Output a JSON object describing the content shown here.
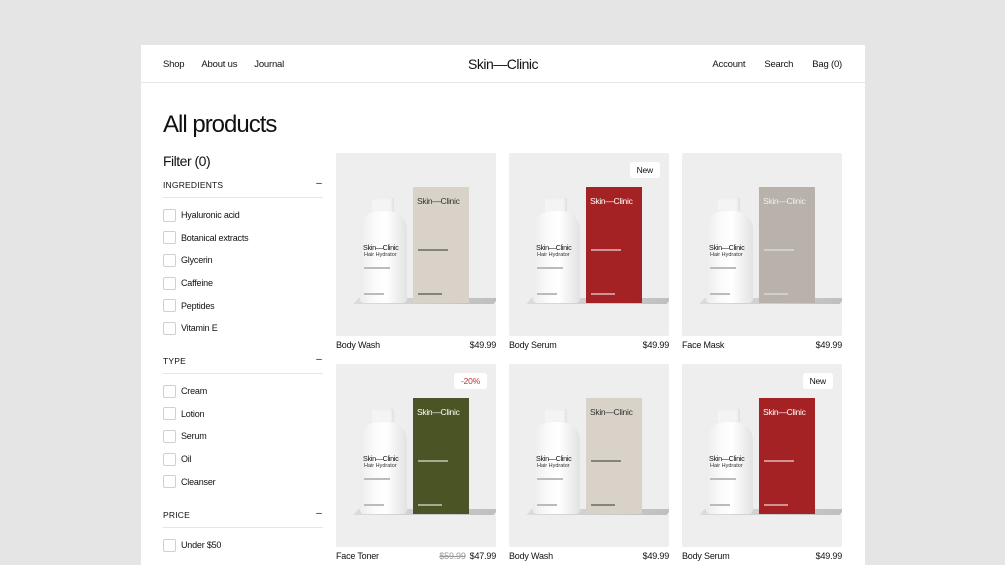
{
  "header": {
    "nav_left": [
      "Shop",
      "About us",
      "Journal"
    ],
    "logo": "Skin—Clinic",
    "nav_right": [
      "Account",
      "Search",
      "Bag (0)"
    ]
  },
  "page_title": "All products",
  "filter": {
    "title": "Filter (0)",
    "sections": [
      {
        "label": "INGREDIENTS",
        "toggle": "–",
        "options": [
          "Hyaluronic acid",
          "Botanical extracts",
          "Glycerin",
          "Caffeine",
          "Peptides",
          "Vitamin E"
        ]
      },
      {
        "label": "TYPE",
        "toggle": "–",
        "options": [
          "Cream",
          "Lotion",
          "Serum",
          "Oil",
          "Cleanser"
        ]
      },
      {
        "label": "PRICE",
        "toggle": "–",
        "options": [
          "Under $50"
        ]
      }
    ]
  },
  "products": [
    {
      "name": "Body Wash",
      "price": "$49.99",
      "old_price": "",
      "badge": "",
      "box_color": "#d9d2c8",
      "box_text_color": "#333333",
      "bottle_name": "Skin—Clinic",
      "bottle_sub": "Hair Hydrator",
      "box_logo": "Skin—Clinic"
    },
    {
      "name": "Body Serum",
      "price": "$49.99",
      "old_price": "",
      "badge": "New",
      "box_color": "#a52224",
      "box_text_color": "#ffffff",
      "bottle_name": "Skin—Clinic",
      "bottle_sub": "Hair Hydrator",
      "box_logo": "Skin—Clinic"
    },
    {
      "name": "Face Mask",
      "price": "$49.99",
      "old_price": "",
      "badge": "",
      "box_color": "#b9b2aa",
      "box_text_color": "#eeeeee",
      "bottle_name": "Skin—Clinic",
      "bottle_sub": "Hair Hydrator",
      "box_logo": "Skin—Clinic"
    },
    {
      "name": "Face Toner",
      "price": "$47.99",
      "old_price": "$59.99",
      "badge": "-20%",
      "box_color": "#4a5424",
      "box_text_color": "#ffffff",
      "bottle_name": "Skin—Clinic",
      "bottle_sub": "Hair Hydrator",
      "box_logo": "Skin—Clinic"
    },
    {
      "name": "Body Wash",
      "price": "$49.99",
      "old_price": "",
      "badge": "",
      "box_color": "#d9d2c8",
      "box_text_color": "#333333",
      "bottle_name": "Skin—Clinic",
      "bottle_sub": "Hair Hydrator",
      "box_logo": "Skin—Clinic"
    },
    {
      "name": "Body Serum",
      "price": "$49.99",
      "old_price": "",
      "badge": "New",
      "box_color": "#a52224",
      "box_text_color": "#ffffff",
      "bottle_name": "Skin—Clinic",
      "bottle_sub": "Hair Hydrator",
      "box_logo": "Skin—Clinic"
    }
  ]
}
